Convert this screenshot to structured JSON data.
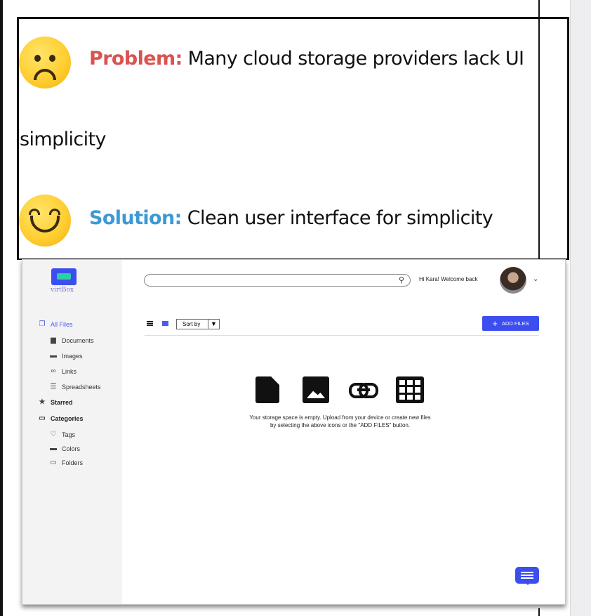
{
  "slide": {
    "problem_label": "Problem:",
    "problem_text": " Many cloud storage providers lack UI",
    "problem_text_cont": "simplicity",
    "solution_label": "Solution:",
    "solution_text": " Clean user interface for simplicity",
    "problem_color": "#d9534f",
    "solution_color": "#3b9ad4"
  },
  "app": {
    "logo": "virtBox",
    "welcome": "Hi Kara! Welcome back",
    "sort_label": "Sort by",
    "add_files": "ADD FILES",
    "empty_line1": "Your storage space is empty. Upload from your device or create new files",
    "empty_line2": "by selecting the above icons or the \"ADD FILES\" button.",
    "accent": "#3c4ef0",
    "sidebar": {
      "all_files": "All Files",
      "documents": "Documents",
      "images": "Images",
      "links": "Links",
      "spreadsheets": "Spreadsheets",
      "starred": "Starred",
      "categories": "Categories",
      "tags": "Tags",
      "colors": "Colors",
      "folders": "Folders"
    }
  }
}
